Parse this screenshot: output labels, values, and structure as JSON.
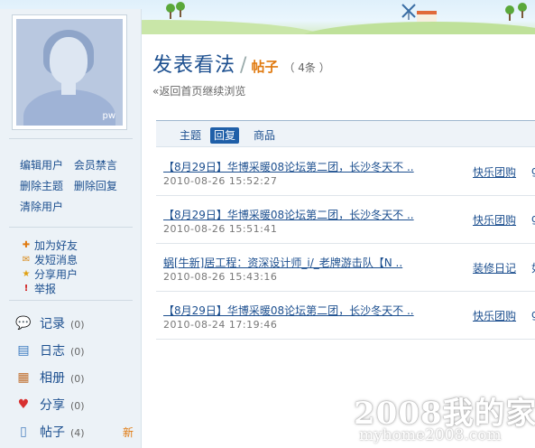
{
  "header": {
    "title": "发表看法",
    "separator": "/",
    "subtitle": "帖子",
    "count": "（ 4条 ）",
    "back_link": "«返回首页继续浏览"
  },
  "avatar": {
    "caption": "pw"
  },
  "admin_links": [
    [
      "编辑用户",
      "会员禁言"
    ],
    [
      "删除主题",
      "删除回复"
    ],
    [
      "清除用户"
    ]
  ],
  "actions": [
    {
      "icon": "add-friend-icon",
      "label": "加为好友"
    },
    {
      "icon": "envelope-icon",
      "label": "发短消息"
    },
    {
      "icon": "star-icon",
      "label": "分享用户"
    },
    {
      "icon": "exclamation-icon",
      "label": "举报"
    }
  ],
  "apps": [
    {
      "icon": "speech-bubble-icon",
      "label": "记录",
      "count": "(0)"
    },
    {
      "icon": "notebook-icon",
      "label": "日志",
      "count": "(0)"
    },
    {
      "icon": "photo-album-icon",
      "label": "相册",
      "count": "(0)"
    },
    {
      "icon": "heart-icon",
      "label": "分享",
      "count": "(0)"
    },
    {
      "icon": "document-icon",
      "label": "帖子",
      "count": "(4)",
      "badge": "新"
    }
  ],
  "tabs": [
    {
      "label": "主题",
      "active": false
    },
    {
      "label": "回复",
      "active": true
    },
    {
      "label": "商品",
      "active": false
    }
  ],
  "posts": [
    {
      "title": "【8月29日】华博采暖08论坛第二团，长沙冬天不 ..",
      "date": "2010-08-26 15:52:27",
      "forum": "快乐团购",
      "extra": "g"
    },
    {
      "title": "【8月29日】华博采暖08论坛第二团，长沙冬天不 ..",
      "date": "2010-08-26 15:51:41",
      "forum": "快乐团购",
      "extra": "g"
    },
    {
      "title": "蜗[牛新]居工程：资深设计师_i/_老牌游击队【N ..",
      "date": "2010-08-26 15:43:16",
      "forum": "装修日记",
      "extra": "如"
    },
    {
      "title": "【8月29日】华博采暖08论坛第二团，长沙冬天不 ..",
      "date": "2010-08-24 17:19:46",
      "forum": "快乐团购",
      "extra": "g"
    }
  ],
  "watermark": {
    "line1": "2008我的家",
    "line2": "myhome2008.com"
  },
  "colors": {
    "link": "#1c4f8f",
    "accent": "#e07a10",
    "active_tab": "#1f5fa8",
    "sidebar_bg": "#ecf2f7"
  }
}
